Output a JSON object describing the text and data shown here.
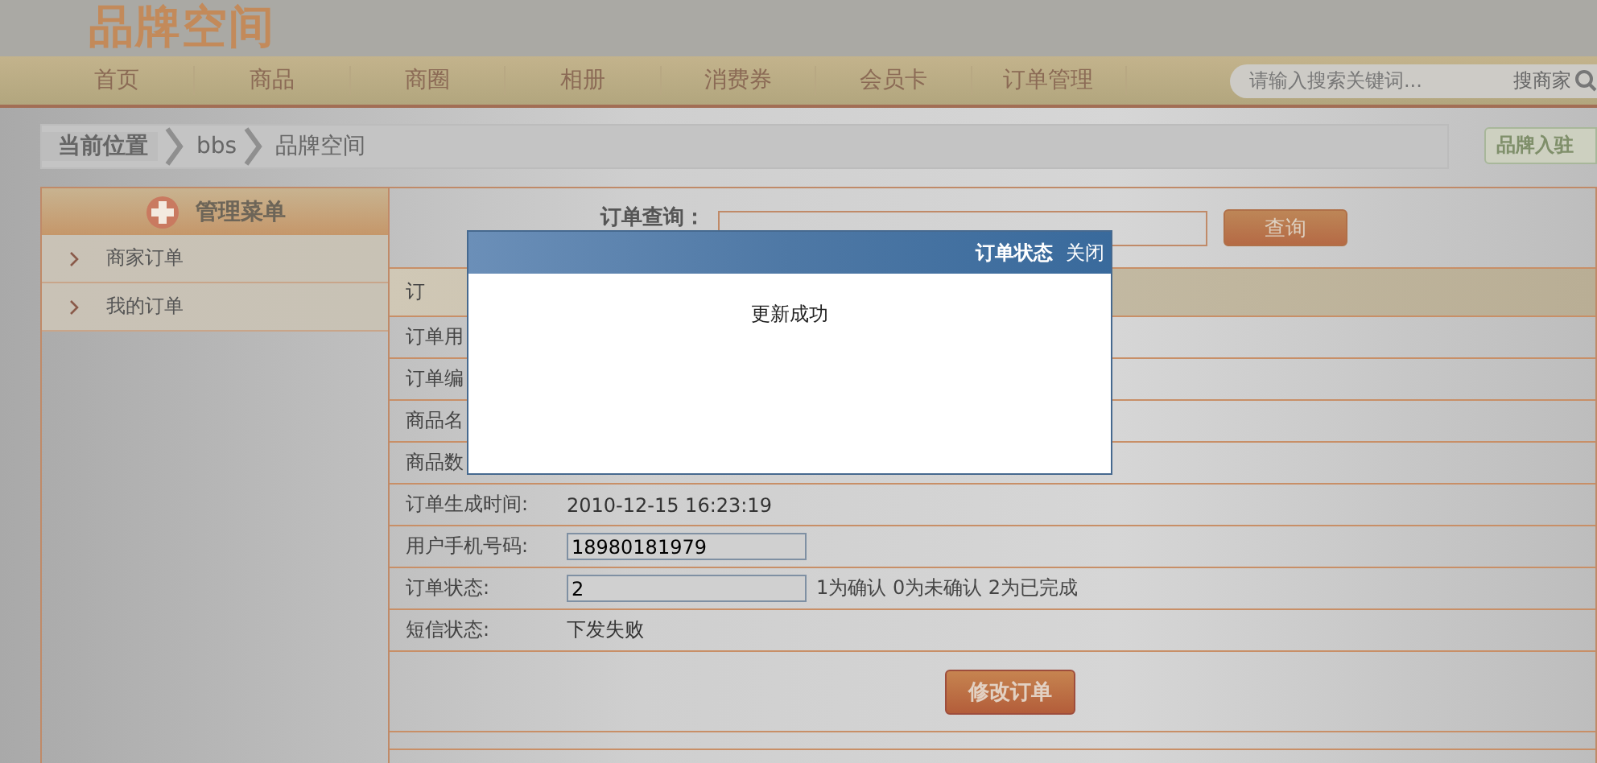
{
  "logo": "品牌空间",
  "nav": [
    {
      "label": "首页"
    },
    {
      "label": "商品"
    },
    {
      "label": "商圈"
    },
    {
      "label": "相册"
    },
    {
      "label": "消费券"
    },
    {
      "label": "会员卡"
    },
    {
      "label": "订单管理"
    }
  ],
  "search": {
    "placeholder": "请输入搜索关键词...",
    "button": "搜商家"
  },
  "breadcrumb": {
    "title": "当前位置",
    "items": [
      "bbs",
      "品牌空间"
    ]
  },
  "join_button": "品牌入驻",
  "sidebar": {
    "title": "管理菜单",
    "items": [
      {
        "label": "商家订单"
      },
      {
        "label": "我的订单"
      }
    ]
  },
  "query": {
    "label": "订单查询：",
    "button": "查询"
  },
  "table_header": "订",
  "rows": [
    {
      "kind": "text",
      "label": "订单用"
    },
    {
      "kind": "text",
      "label": "订单编"
    },
    {
      "kind": "text",
      "label": "商品名"
    },
    {
      "kind": "text",
      "label": "商品数"
    },
    {
      "kind": "text",
      "label": "订单生成时间:",
      "value": "2010-12-15 16:23:19"
    },
    {
      "kind": "input",
      "label": "用户手机号码:",
      "value": "18980181979"
    },
    {
      "kind": "input",
      "label": "订单状态:",
      "value": "2",
      "hint": "1为确认 0为未确认 2为已完成"
    },
    {
      "kind": "text",
      "label": "短信状态:",
      "value": "下发失败"
    }
  ],
  "submit_button": "修改订单",
  "dialog": {
    "title": "订单状态",
    "close": "关闭",
    "message": "更新成功"
  }
}
